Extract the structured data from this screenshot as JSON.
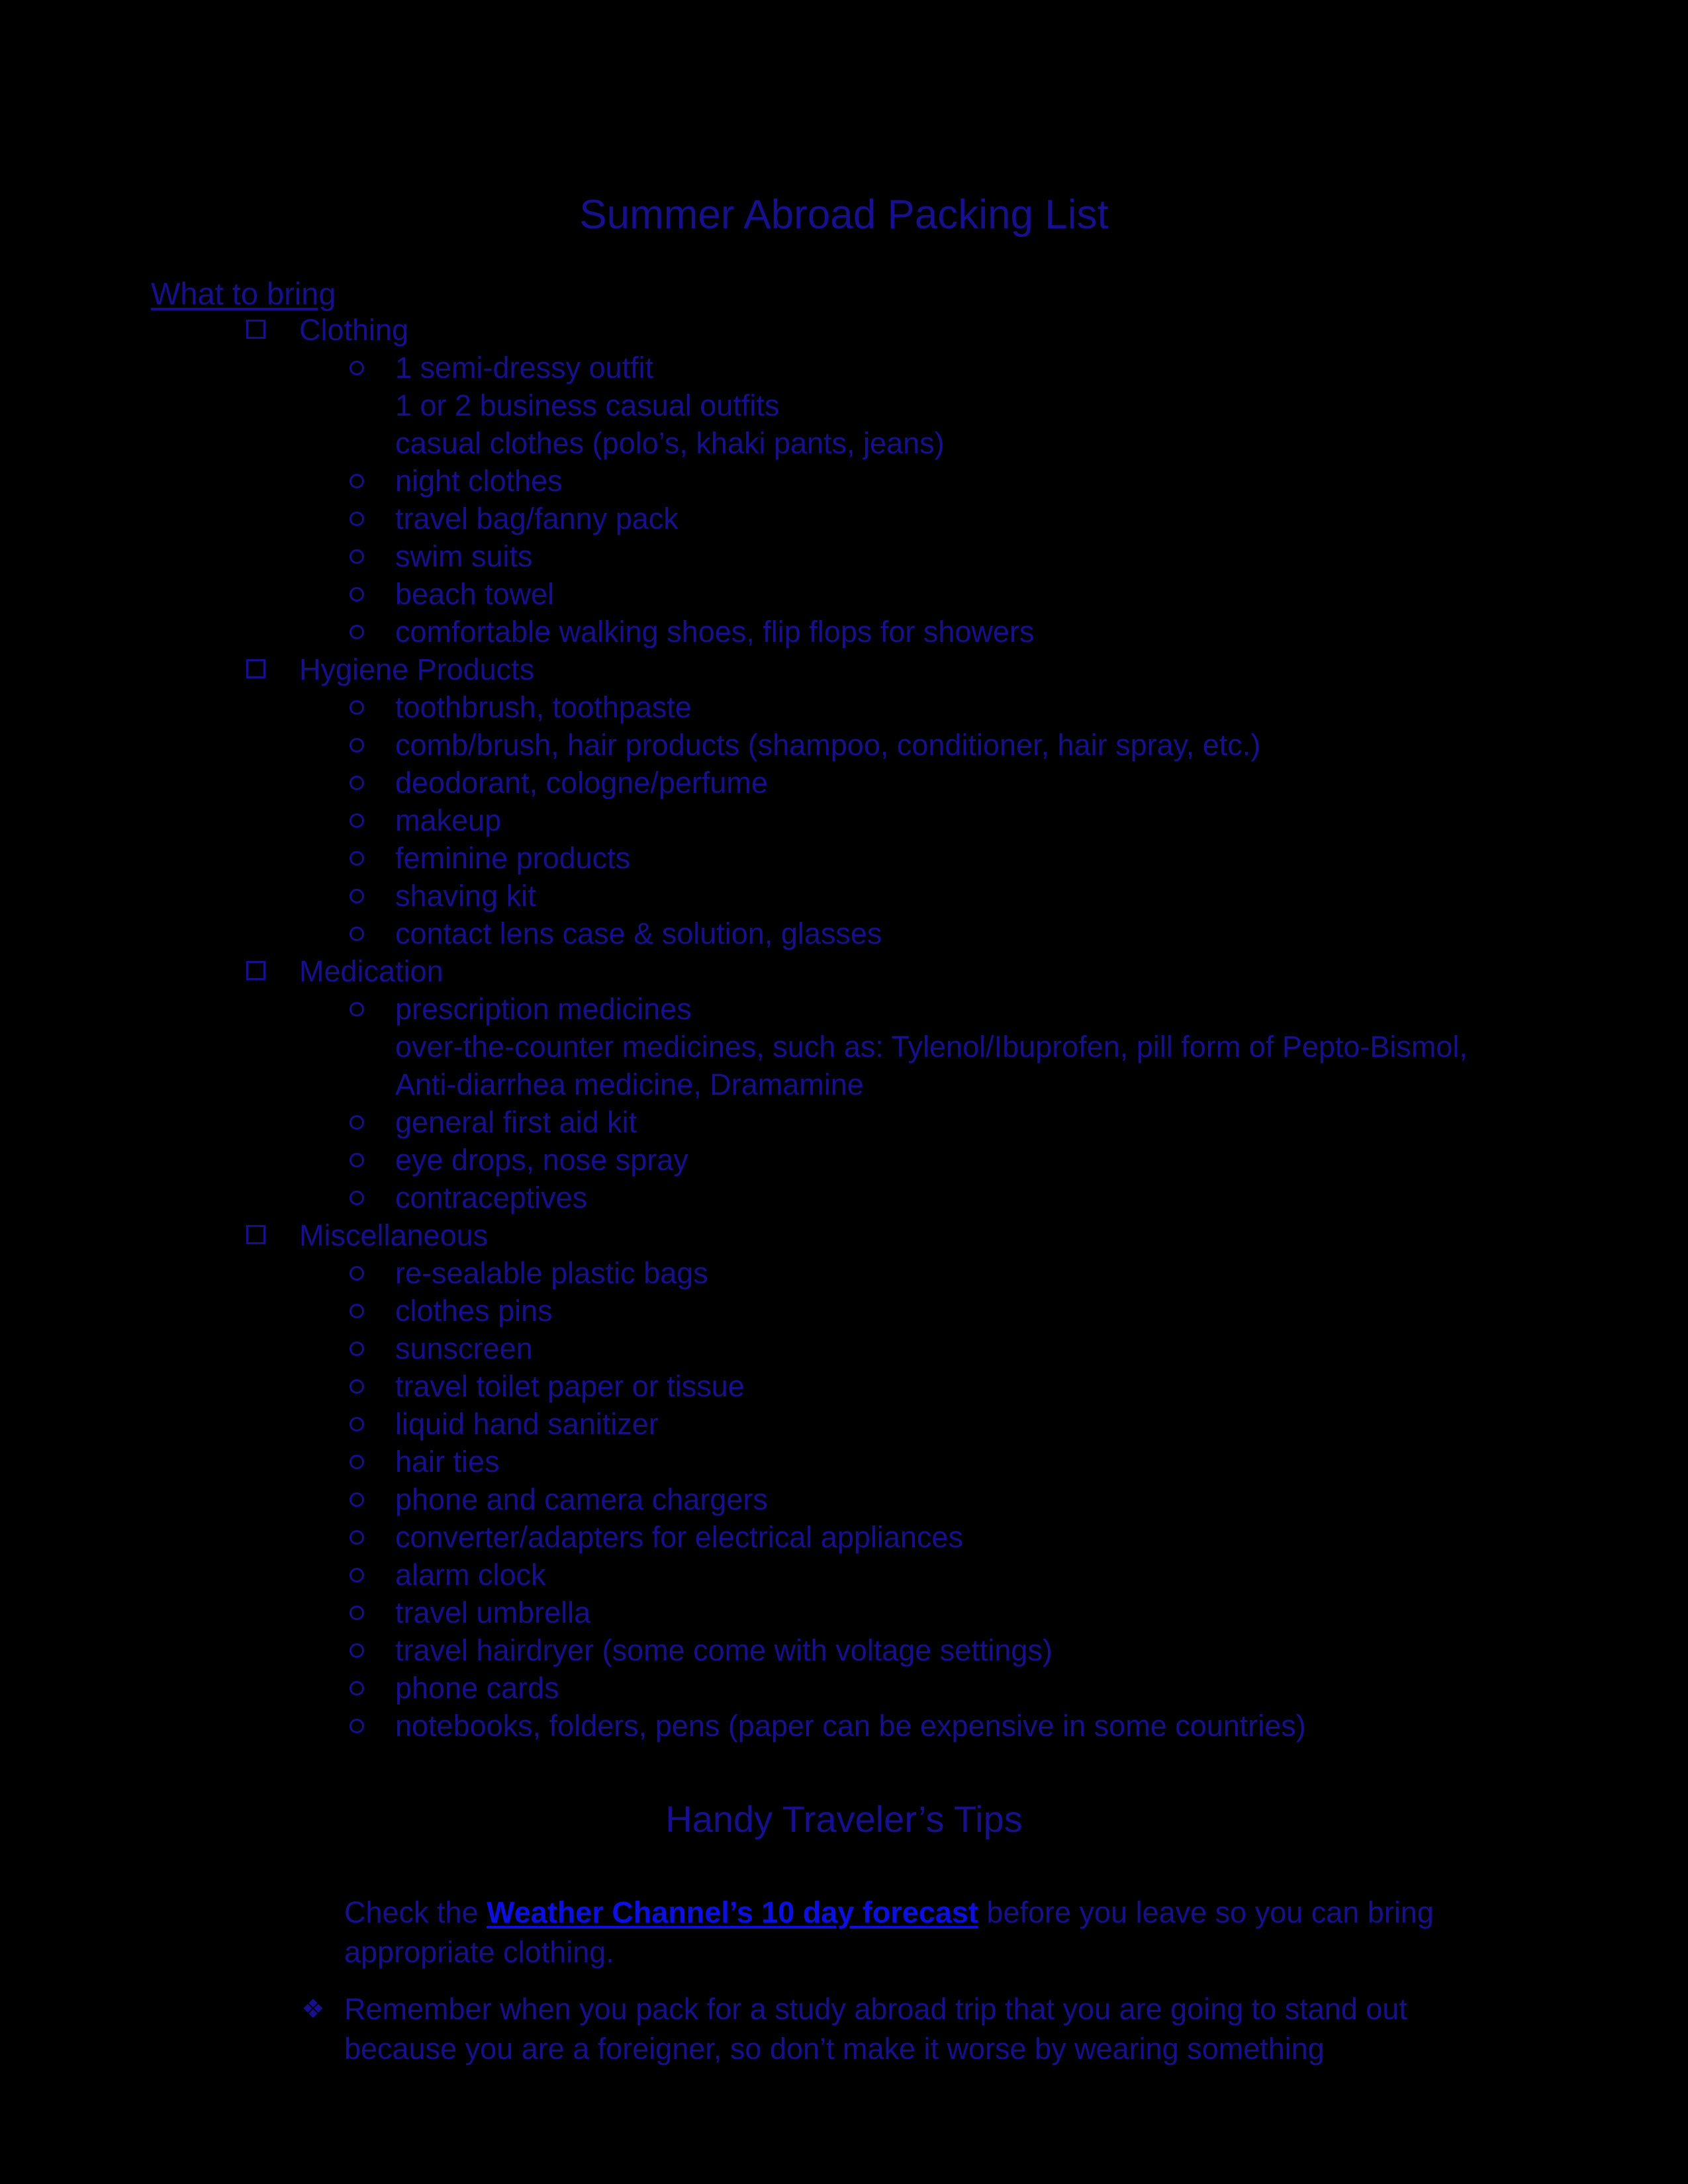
{
  "document": {
    "title": "Summer Abroad Packing List",
    "text_color": "#16108c",
    "link_color": "#0b10e0",
    "background_color": "#000000"
  },
  "section_heading": "What to bring",
  "markers": {
    "level1": "□",
    "level2": "o",
    "tip": "❖"
  },
  "outline": [
    {
      "level": 1,
      "text": "Clothing"
    },
    {
      "level": 2,
      "text": "1 semi-dressy outfit"
    },
    {
      "level": 0,
      "text": "1 or 2 business casual outfits"
    },
    {
      "level": 0,
      "text": "casual clothes (polo’s, khaki pants, jeans)"
    },
    {
      "level": 2,
      "text": "night clothes"
    },
    {
      "level": 2,
      "text": "travel bag/fanny pack"
    },
    {
      "level": 2,
      "text": "swim suits"
    },
    {
      "level": 2,
      "text": "beach towel"
    },
    {
      "level": 2,
      "text": "comfortable walking shoes, flip flops for showers"
    },
    {
      "level": 1,
      "text": "Hygiene Products"
    },
    {
      "level": 2,
      "text": "toothbrush, toothpaste"
    },
    {
      "level": 2,
      "text": "comb/brush, hair products (shampoo, conditioner, hair spray, etc.)"
    },
    {
      "level": 2,
      "text": "deodorant, cologne/perfume"
    },
    {
      "level": 2,
      "text": "makeup"
    },
    {
      "level": 2,
      "text": "feminine products"
    },
    {
      "level": 2,
      "text": "shaving kit"
    },
    {
      "level": 2,
      "text": "contact lens case & solution, glasses"
    },
    {
      "level": 1,
      "text": "Medication"
    },
    {
      "level": 2,
      "text": "prescription medicines"
    },
    {
      "level": 0,
      "text": "over-the-counter medicines, such as: Tylenol/Ibuprofen, pill form of Pepto-Bismol,"
    },
    {
      "level": 0,
      "text": "Anti-diarrhea medicine, Dramamine"
    },
    {
      "level": 2,
      "text": "general first aid kit"
    },
    {
      "level": 2,
      "text": "eye drops, nose spray"
    },
    {
      "level": 2,
      "text": "contraceptives"
    },
    {
      "level": 1,
      "text": "Miscellaneous"
    },
    {
      "level": 2,
      "text": "re-sealable plastic bags"
    },
    {
      "level": 2,
      "text": "clothes pins"
    },
    {
      "level": 2,
      "text": "sunscreen"
    },
    {
      "level": 2,
      "text": "travel toilet paper or tissue"
    },
    {
      "level": 2,
      "text": "liquid hand sanitizer"
    },
    {
      "level": 2,
      "text": "hair ties"
    },
    {
      "level": 2,
      "text": "phone and camera chargers"
    },
    {
      "level": 2,
      "text": "converter/adapters for electrical appliances"
    },
    {
      "level": 2,
      "text": "alarm clock"
    },
    {
      "level": 2,
      "text": "travel umbrella"
    },
    {
      "level": 2,
      "text": "travel hairdryer (some come with voltage settings)"
    },
    {
      "level": 2,
      "text": "phone cards"
    },
    {
      "level": 2,
      "text": "notebooks, folders, pens (paper can be expensive in some countries)"
    }
  ],
  "tips": {
    "heading": "Handy Traveler’s Tips",
    "paragraph1": {
      "before_link": "Check the ",
      "link_text": "Weather Channel’s 10 day forecast",
      "after_link": " before you leave so you can bring appropriate clothing."
    },
    "paragraph2": "Remember when you pack for a study abroad trip that you are going to stand out because you are a foreigner, so don’t make it worse by wearing something"
  }
}
